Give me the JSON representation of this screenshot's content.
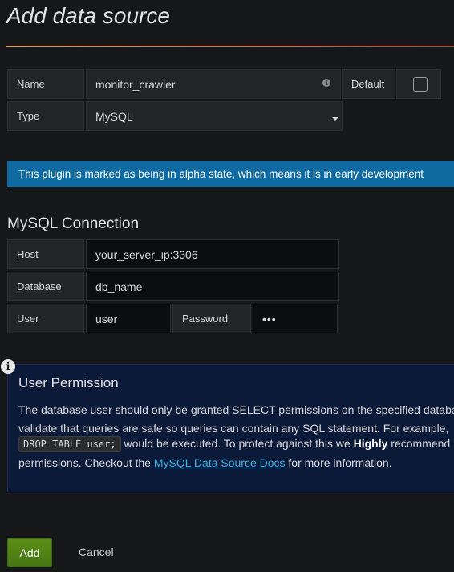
{
  "page": {
    "title": "Add data source"
  },
  "settings": {
    "name_label": "Name",
    "name_value": "monitor_crawler",
    "default_label": "Default",
    "type_label": "Type",
    "type_value": "MySQL"
  },
  "alert": {
    "text": "This plugin is marked as being in alpha state, which means it is in early development"
  },
  "connection": {
    "heading": "MySQL Connection",
    "host_label": "Host",
    "host_value": "your_server_ip:3306",
    "database_label": "Database",
    "database_value": "db_name",
    "user_label": "User",
    "user_value": "user",
    "password_label": "Password",
    "password_value": "•••"
  },
  "permission": {
    "title": "User Permission",
    "line1": "The database user should only be granted SELECT permissions on the specified database",
    "line2": "validate that queries are safe so queries can contain any SQL statement. For example,",
    "code": "DROP TABLE user;",
    "line3_after_code": "would be executed. To protect against this we",
    "line3_bold": "Highly",
    "line3_end": "recommend",
    "line4_before": "permissions. Checkout the",
    "link_text": "MySQL Data Source Docs",
    "line4_after": "for more information."
  },
  "actions": {
    "add_label": "Add",
    "cancel_label": "Cancel"
  }
}
